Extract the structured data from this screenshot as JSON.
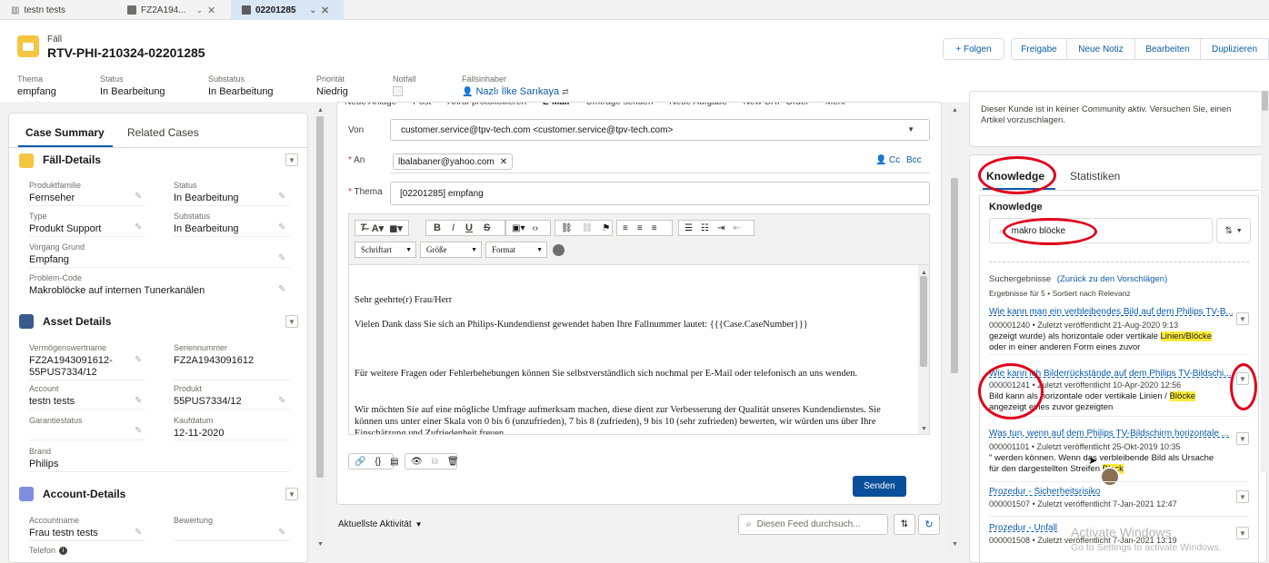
{
  "tabs": [
    {
      "label": "testn tests",
      "icon": "account-icon"
    },
    {
      "label": "FZ2A194...",
      "icon": "asset-icon"
    },
    {
      "label": "02201285",
      "icon": "case-icon"
    }
  ],
  "header": {
    "object_label": "Fäll",
    "title": "RTV-PHI-210324-02201285",
    "buttons": {
      "follow": "+ Folgen",
      "release": "Freigabe",
      "new_note": "Neue Notiz",
      "edit": "Bearbeiten",
      "duplicate": "Duplizieren"
    },
    "highlights": [
      {
        "label": "Thema",
        "value": "empfang"
      },
      {
        "label": "Status",
        "value": "In Bearbeitung"
      },
      {
        "label": "Substatus",
        "value": "In Bearbeitung"
      },
      {
        "label": "Priorität",
        "value": "Niedrig"
      },
      {
        "label": "Notfall",
        "value": ""
      },
      {
        "label": "Fällsinhaber",
        "value": "Nazlı İlke Sarıkaya"
      }
    ]
  },
  "left": {
    "tabs": {
      "summary": "Case Summary",
      "related": "Related Cases"
    },
    "case_details": {
      "title": "Fäll-Details",
      "fields": {
        "produktfamilie_label": "Produktfamilie",
        "produktfamilie": "Fernseher",
        "status_label": "Status",
        "status": "In Bearbeitung",
        "type_label": "Type",
        "type": "Produkt Support",
        "substatus_label": "Substatus",
        "substatus": "In Bearbeitung",
        "vorgang_label": "Vorgang Grund",
        "vorgang": "Empfang",
        "problem_label": "Problem-Code",
        "problem": "Makroblöcke auf internen Tunerkanälen"
      }
    },
    "asset_details": {
      "title": "Asset Details",
      "fields": {
        "name_label": "Vermögenswertname",
        "name_line1": "FZ2A1943091612-",
        "name_line2": "55PUS7334/12",
        "serial_label": "Seriennummer",
        "serial": "FZ2A1943091612",
        "account_label": "Account",
        "account": "testn tests",
        "product_label": "Produkt",
        "product": "55PUS7334/12",
        "warranty_label": "Garantiestatus",
        "warranty": "",
        "purchase_label": "Kaufdatum",
        "purchase": "12-11-2020",
        "brand_label": "Brand",
        "brand": "Philips"
      }
    },
    "account_details": {
      "title": "Account-Details",
      "fields": {
        "accname_label": "Accountname",
        "accname": "Frau testn tests",
        "rating_label": "Bewertung",
        "rating": "",
        "phone_label": "Telefon"
      }
    }
  },
  "email": {
    "top_tabs": [
      "Neue Anlage",
      "Post",
      "Anruf protokollieren",
      "E-Mail",
      "Umfrage senden",
      "Neue Aufgabe",
      "New CRP Order",
      "Mehr"
    ],
    "from_label": "Von",
    "from_value": "customer.service@tpv-tech.com <customer.service@tpv-tech.com>",
    "to_label": "An",
    "to_pill": "lbalabaner@yahoo.com",
    "cc": "Cc",
    "bcc": "Bcc",
    "subject_label": "Thema",
    "subject_value": "[02201285] empfang",
    "font_select": "Schriftart",
    "size_select": "Größe",
    "format_select": "Format",
    "body": [
      "Sehr geehrte(r) Frau/Herr",
      "Vielen Dank dass Sie sich an Philips-Kundendienst gewendet haben Ihre Fallnummer lautet: {{{Case.CaseNumber}}}",
      "Für weitere Fragen oder Fehlerbehebungen können Sie selbstverständlich sich nochmal per E-Mail oder telefonisch an uns wenden.",
      "Wir möchten Sie auf eine mögliche Umfrage aufmerksam machen, diese dient zur Verbesserung der Qualität unseres Kundendienstes. Sie können uns unter einer Skala von 0 bis 6 (unzufrieden), 7 bis 8 (zufrieden), 9 bis 10 (sehr zufrieden) bewerten, wir würden uns über Ihre Einschätzung und Zufriedenheit freuen."
    ],
    "send": "Senden",
    "activity": "Aktuellste Aktivität",
    "feed_search_placeholder": "Diesen Feed durchsuch..."
  },
  "right": {
    "community_note": "Dieser Kunde ist in keiner Community aktiv. Versuchen Sie, einen Artikel vorzuschlagen.",
    "tabs": {
      "knowledge": "Knowledge",
      "stats": "Statistiken"
    },
    "knowledge_title": "Knowledge",
    "search_value": "makro blöcke",
    "results_label": "Suchergebnisse",
    "back_link": "(Zurück zu den Vorschlägen)",
    "results_meta": "Ergebnisse für 5 • Sortiert nach Relevanz",
    "results": [
      {
        "title": "Wie kann man ein verbleibendes Bild auf dem Philips TV-B...",
        "number": "000001240",
        "published": "Zuletzt veröffentlicht",
        "date": "21-Aug-2020 9:13",
        "line1_pre": "gezeigt wurde) als horizontale oder vertikale ",
        "line1_hl": "Linien/Blöcke",
        "line2": "oder in einer anderen Form eines zuvor"
      },
      {
        "title": "Wie kann ich Bilderrückstände auf dem Philips TV-Bildschi...",
        "number": "000001241",
        "published": "Zuletzt veröffentlicht",
        "date": "10-Apr-2020 12:56",
        "line1_pre": "Bild kann als horizontale oder vertikale Linien / ",
        "line1_hl": "Blöcke",
        "line2": "angezeigt eines zuvor gezeigten"
      },
      {
        "title": "Was tun, wenn auf dem Philips TV-Bildschirm horizontale ...",
        "number": "000001101",
        "published": "Zuletzt veröffentlicht",
        "date": "25-Okt-2019 10:35",
        "line1_pre": "\" werden können. Wenn das verbleibende Bild als Ursache",
        "line1_hl": "",
        "line2_pre": "für den dargestellten Streifen ",
        "line2_hl": "Block"
      },
      {
        "title": "Prozedur - Sicherheitsrisiko",
        "number": "000001507",
        "published": "Zuletzt veröffentlicht",
        "date": "7-Jan-2021 12:47"
      },
      {
        "title": "Prozedur - Unfall",
        "number": "000001508",
        "published": "Zuletzt veröffentlicht",
        "date": "7-Jan-2021 13:19"
      }
    ],
    "watermark_1": "Activate Windows",
    "watermark_2": "Go to Settings to activate Windows."
  }
}
